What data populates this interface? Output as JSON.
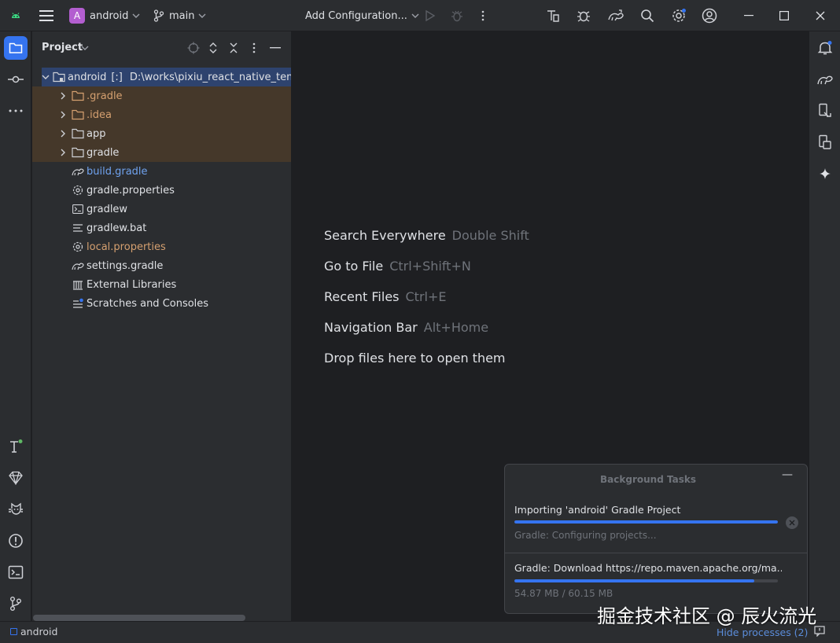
{
  "colors": {
    "accent": "#3574f0",
    "project_badge": "#b35ed0",
    "excluded_text": "#d5a070",
    "modified_text": "#6fa2ee"
  },
  "titlebar": {
    "project_badge": "A",
    "project_name": "android",
    "branch": "main",
    "run_config": "Add Configuration...",
    "icons": [
      "android-logo-icon",
      "hamburger-menu-icon",
      "chevron-down-icon",
      "branch-icon",
      "run-icon",
      "debug-icon",
      "more-vertical-icon",
      "device-manager-icon",
      "bug-icon",
      "gradle-sync-icon",
      "search-icon",
      "settings-icon",
      "account-icon",
      "minimize-icon",
      "maximize-icon",
      "close-icon"
    ]
  },
  "left_stripe": {
    "icons": [
      "project-folder-icon",
      "commit-icon",
      "more-horizontal-icon",
      "build-icon",
      "gem-icon",
      "cat-icon",
      "problems-icon",
      "terminal-icon",
      "git-icon"
    ]
  },
  "project_panel": {
    "title": "Project",
    "tree": [
      {
        "label": "android",
        "suffix": "[:]",
        "path": "D:\\works\\pixiu_react_native_template"
      },
      {
        "label": ".gradle"
      },
      {
        "label": ".idea"
      },
      {
        "label": "app"
      },
      {
        "label": "gradle"
      },
      {
        "label": "build.gradle"
      },
      {
        "label": "gradle.properties"
      },
      {
        "label": "gradlew"
      },
      {
        "label": "gradlew.bat"
      },
      {
        "label": "local.properties"
      },
      {
        "label": "settings.gradle"
      },
      {
        "label": "External Libraries"
      },
      {
        "label": "Scratches and Consoles"
      }
    ]
  },
  "editor": {
    "hints": [
      {
        "action": "Search Everywhere",
        "shortcut": "Double Shift"
      },
      {
        "action": "Go to File",
        "shortcut": "Ctrl+Shift+N"
      },
      {
        "action": "Recent Files",
        "shortcut": "Ctrl+E"
      },
      {
        "action": "Navigation Bar",
        "shortcut": "Alt+Home"
      },
      {
        "action": "Drop files here to open them",
        "shortcut": ""
      }
    ]
  },
  "right_stripe": {
    "icons": [
      "notifications-icon",
      "gradle-icon",
      "device-explorer-icon",
      "running-devices-icon",
      "gemini-icon"
    ]
  },
  "background_tasks": {
    "title": "Background Tasks",
    "minimize_label": "—",
    "tasks": [
      {
        "name": "Importing 'android' Gradle Project",
        "status": "Gradle: Configuring projects...",
        "progress": 1.0
      },
      {
        "name": "Gradle: Download https://repo.maven.apache.org/ma...",
        "status": "54.87 MB / 60.15 MB",
        "progress": 0.91
      }
    ]
  },
  "statusbar": {
    "left": "android",
    "right": "Hide processes (2)"
  },
  "watermark": "掘金技术社区 @ 辰火流光"
}
